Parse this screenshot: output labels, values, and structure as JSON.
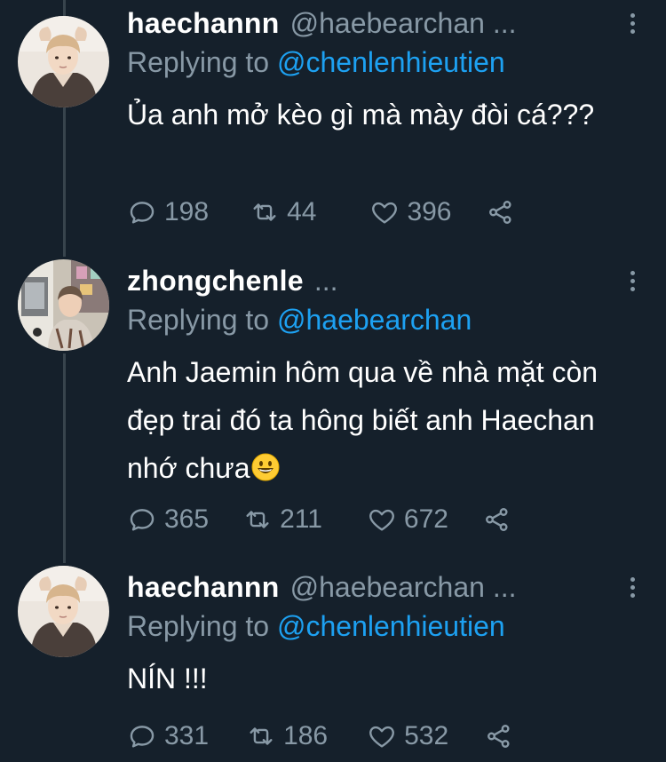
{
  "tweets": [
    {
      "display_name": "haechannn",
      "handle": "@haebearchan ...",
      "reply_prefix": "Replying to",
      "reply_handle": "@chenlenhieutien",
      "text": "Ủa anh mở kèo gì mà mày đòi cá???",
      "replies": "198",
      "retweets": "44",
      "likes": "396"
    },
    {
      "display_name": "zhongchenle",
      "handle": "...",
      "reply_prefix": "Replying to",
      "reply_handle": "@haebearchan",
      "text": "Anh Jaemin hôm qua về nhà mặt còn đẹp trai đó ta hông biết anh Haechan nhớ chưa",
      "emoji": "grinning-face",
      "replies": "365",
      "retweets": "211",
      "likes": "672"
    },
    {
      "display_name": "haechannn",
      "handle": "@haebearchan ...",
      "reply_prefix": "Replying to",
      "reply_handle": "@chenlenhieutien",
      "text": "NÍN !!!",
      "replies": "331",
      "retweets": "186",
      "likes": "532"
    }
  ],
  "icons": {
    "reply": "reply-icon",
    "retweet": "retweet-icon",
    "like": "heart-icon",
    "share": "share-icon",
    "more": "more-vertical-icon"
  },
  "colors": {
    "background": "#15202b",
    "text": "#ffffff",
    "muted": "#8899a6",
    "link": "#1da1f2",
    "thread_line": "#38444d"
  }
}
